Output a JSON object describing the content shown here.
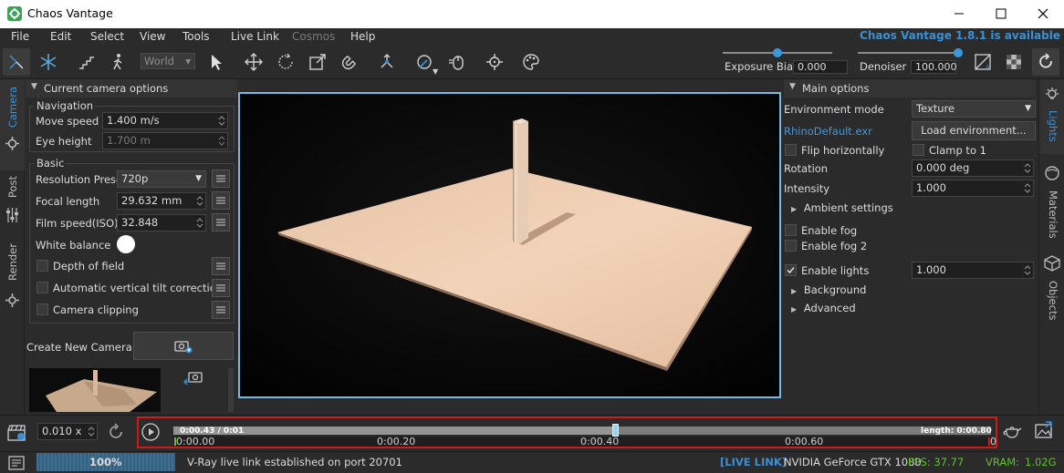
{
  "window": {
    "title": "Chaos Vantage"
  },
  "menu": [
    {
      "label": "File",
      "enabled": true
    },
    {
      "label": "Edit",
      "enabled": true
    },
    {
      "label": "Select",
      "enabled": true
    },
    {
      "label": "View",
      "enabled": true
    },
    {
      "label": "Tools",
      "enabled": true
    },
    {
      "label": "Live Link",
      "enabled": true
    },
    {
      "label": "Cosmos",
      "enabled": false
    },
    {
      "label": "Help",
      "enabled": true
    }
  ],
  "update_notice": "Chaos Vantage 1.8.1 is available",
  "toolbar": {
    "space_selector": "World",
    "exposure_bias_label": "Exposure Bias",
    "exposure_bias_value": "0.000",
    "exposure_bias_slider_fraction": 0.5,
    "denoiser_label": "Denoiser",
    "denoiser_value": "100.000",
    "denoiser_slider_fraction": 1.0
  },
  "left_tabs": [
    "Camera",
    "Post",
    "Render"
  ],
  "camera_panel": {
    "section_title": "Current camera options",
    "navigation_group": "Navigation",
    "move_speed_label": "Move speed",
    "move_speed_value": "1.400 m/s",
    "eye_height_label": "Eye height",
    "eye_height_value": "1.700 m",
    "basic_group": "Basic",
    "resolution_preset_label": "Resolution Preset",
    "resolution_preset_value": "720p",
    "focal_length_label": "Focal length",
    "focal_length_value": "29.632 mm",
    "film_speed_label": "Film speed(ISO)",
    "film_speed_value": "32.848",
    "white_balance_label": "White balance",
    "white_balance_color": "#ffffff",
    "depth_of_field_label": "Depth of field",
    "tilt_correction_label": "Automatic vertical tilt correction",
    "camera_clipping_label": "Camera clipping",
    "create_camera_label": "Create New Camera"
  },
  "right_tabs": [
    "Lights",
    "Materials",
    "Objects"
  ],
  "lights_panel": {
    "section_title": "Main options",
    "environment_mode_label": "Environment mode",
    "environment_mode_value": "Texture",
    "environment_file": "RhinoDefault.exr",
    "load_environment_label": "Load environment...",
    "flip_horizontally_label": "Flip horizontally",
    "clamp_label": "Clamp to 1",
    "rotation_label": "Rotation",
    "rotation_value": "0.000 deg",
    "intensity_label": "Intensity",
    "intensity_value": "1.000",
    "ambient_settings_label": "Ambient settings",
    "enable_fog_label": "Enable fog",
    "enable_fog2_label": "Enable fog 2",
    "enable_lights_label": "Enable lights",
    "enable_lights_checked": true,
    "enable_lights_value": "1.000",
    "background_label": "Background",
    "advanced_label": "Advanced"
  },
  "timeline": {
    "playback_speed": "0.010 x",
    "current_time": "0:00.43 / 0:01",
    "length": "length: 0:00.80",
    "playhead_fraction": 0.54,
    "ticks": [
      "0:00.00",
      "0:00.20",
      "0:00.40",
      "0:00.60"
    ],
    "end_marker": "0"
  },
  "status": {
    "progress": "100%",
    "message": "V-Ray live link established on port 20701",
    "live_link": "[LIVE LINK]",
    "gpu": "NVIDIA GeForce GTX 1080",
    "fps": "FPS: 37.77",
    "vram": "VRAM:",
    "vram_value": "1.02G"
  },
  "colors": {
    "accent_blue": "#3c8fd4",
    "timeline_highlight": "#d11a1a",
    "fps_green": "#62c12c"
  }
}
